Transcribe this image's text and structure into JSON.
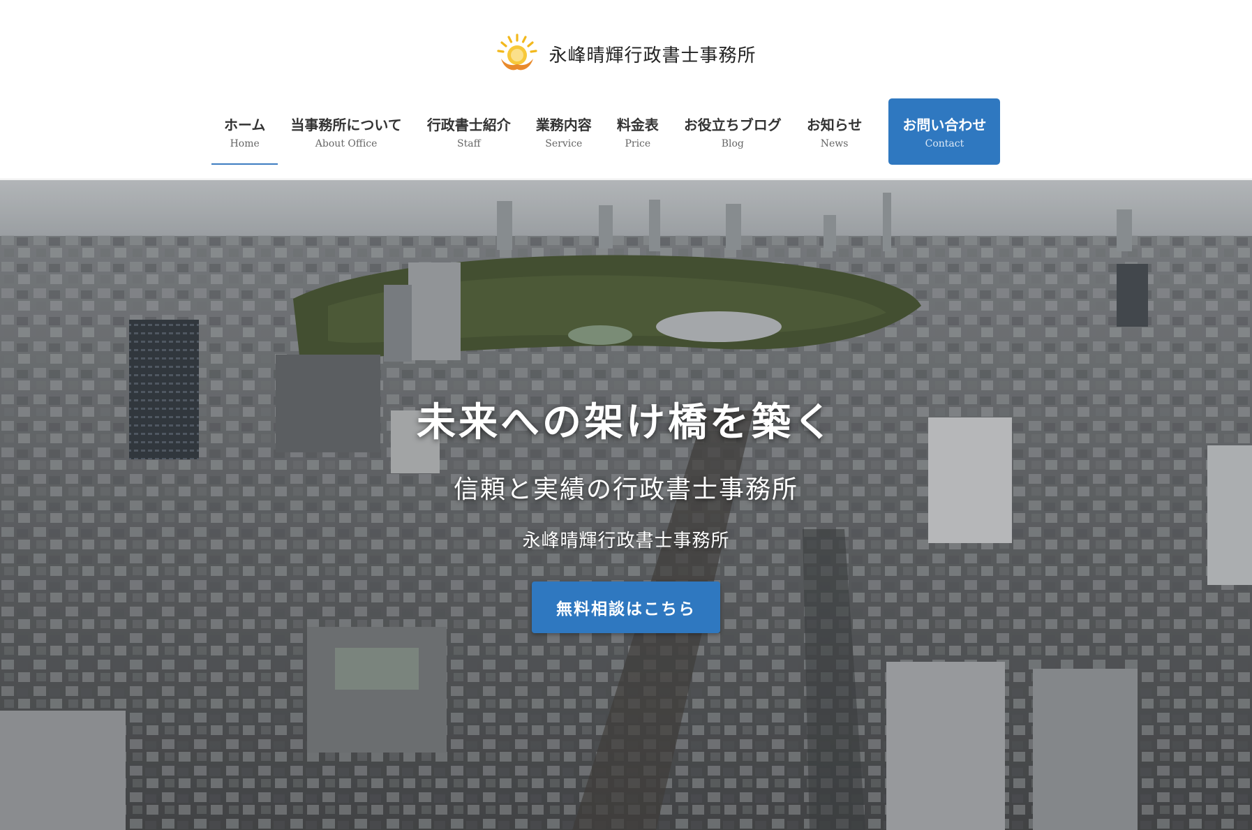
{
  "brand": {
    "logo_icon": "sun-hands-logo",
    "name": "永峰晴輝行政書士事務所"
  },
  "nav": {
    "items": [
      {
        "ja": "ホーム",
        "en": "Home",
        "active": true
      },
      {
        "ja": "当事務所について",
        "en": "About Office"
      },
      {
        "ja": "行政書士紹介",
        "en": "Staff"
      },
      {
        "ja": "業務内容",
        "en": "Service"
      },
      {
        "ja": "料金表",
        "en": "Price"
      },
      {
        "ja": "お役立ちブログ",
        "en": "Blog"
      },
      {
        "ja": "お知らせ",
        "en": "News"
      }
    ],
    "contact": {
      "ja": "お問い合わせ",
      "en": "Contact"
    }
  },
  "hero": {
    "background": "aerial-city-photo",
    "headline": "未来への架け橋を築く",
    "subline": "信頼と実績の行政書士事務所",
    "office_name": "永峰晴輝行政書士事務所",
    "cta_label": "無料相談はこちら"
  },
  "colors": {
    "accent": "#2f78c0",
    "logo_yellow": "#f2b81c",
    "logo_orange": "#e98a2b"
  }
}
